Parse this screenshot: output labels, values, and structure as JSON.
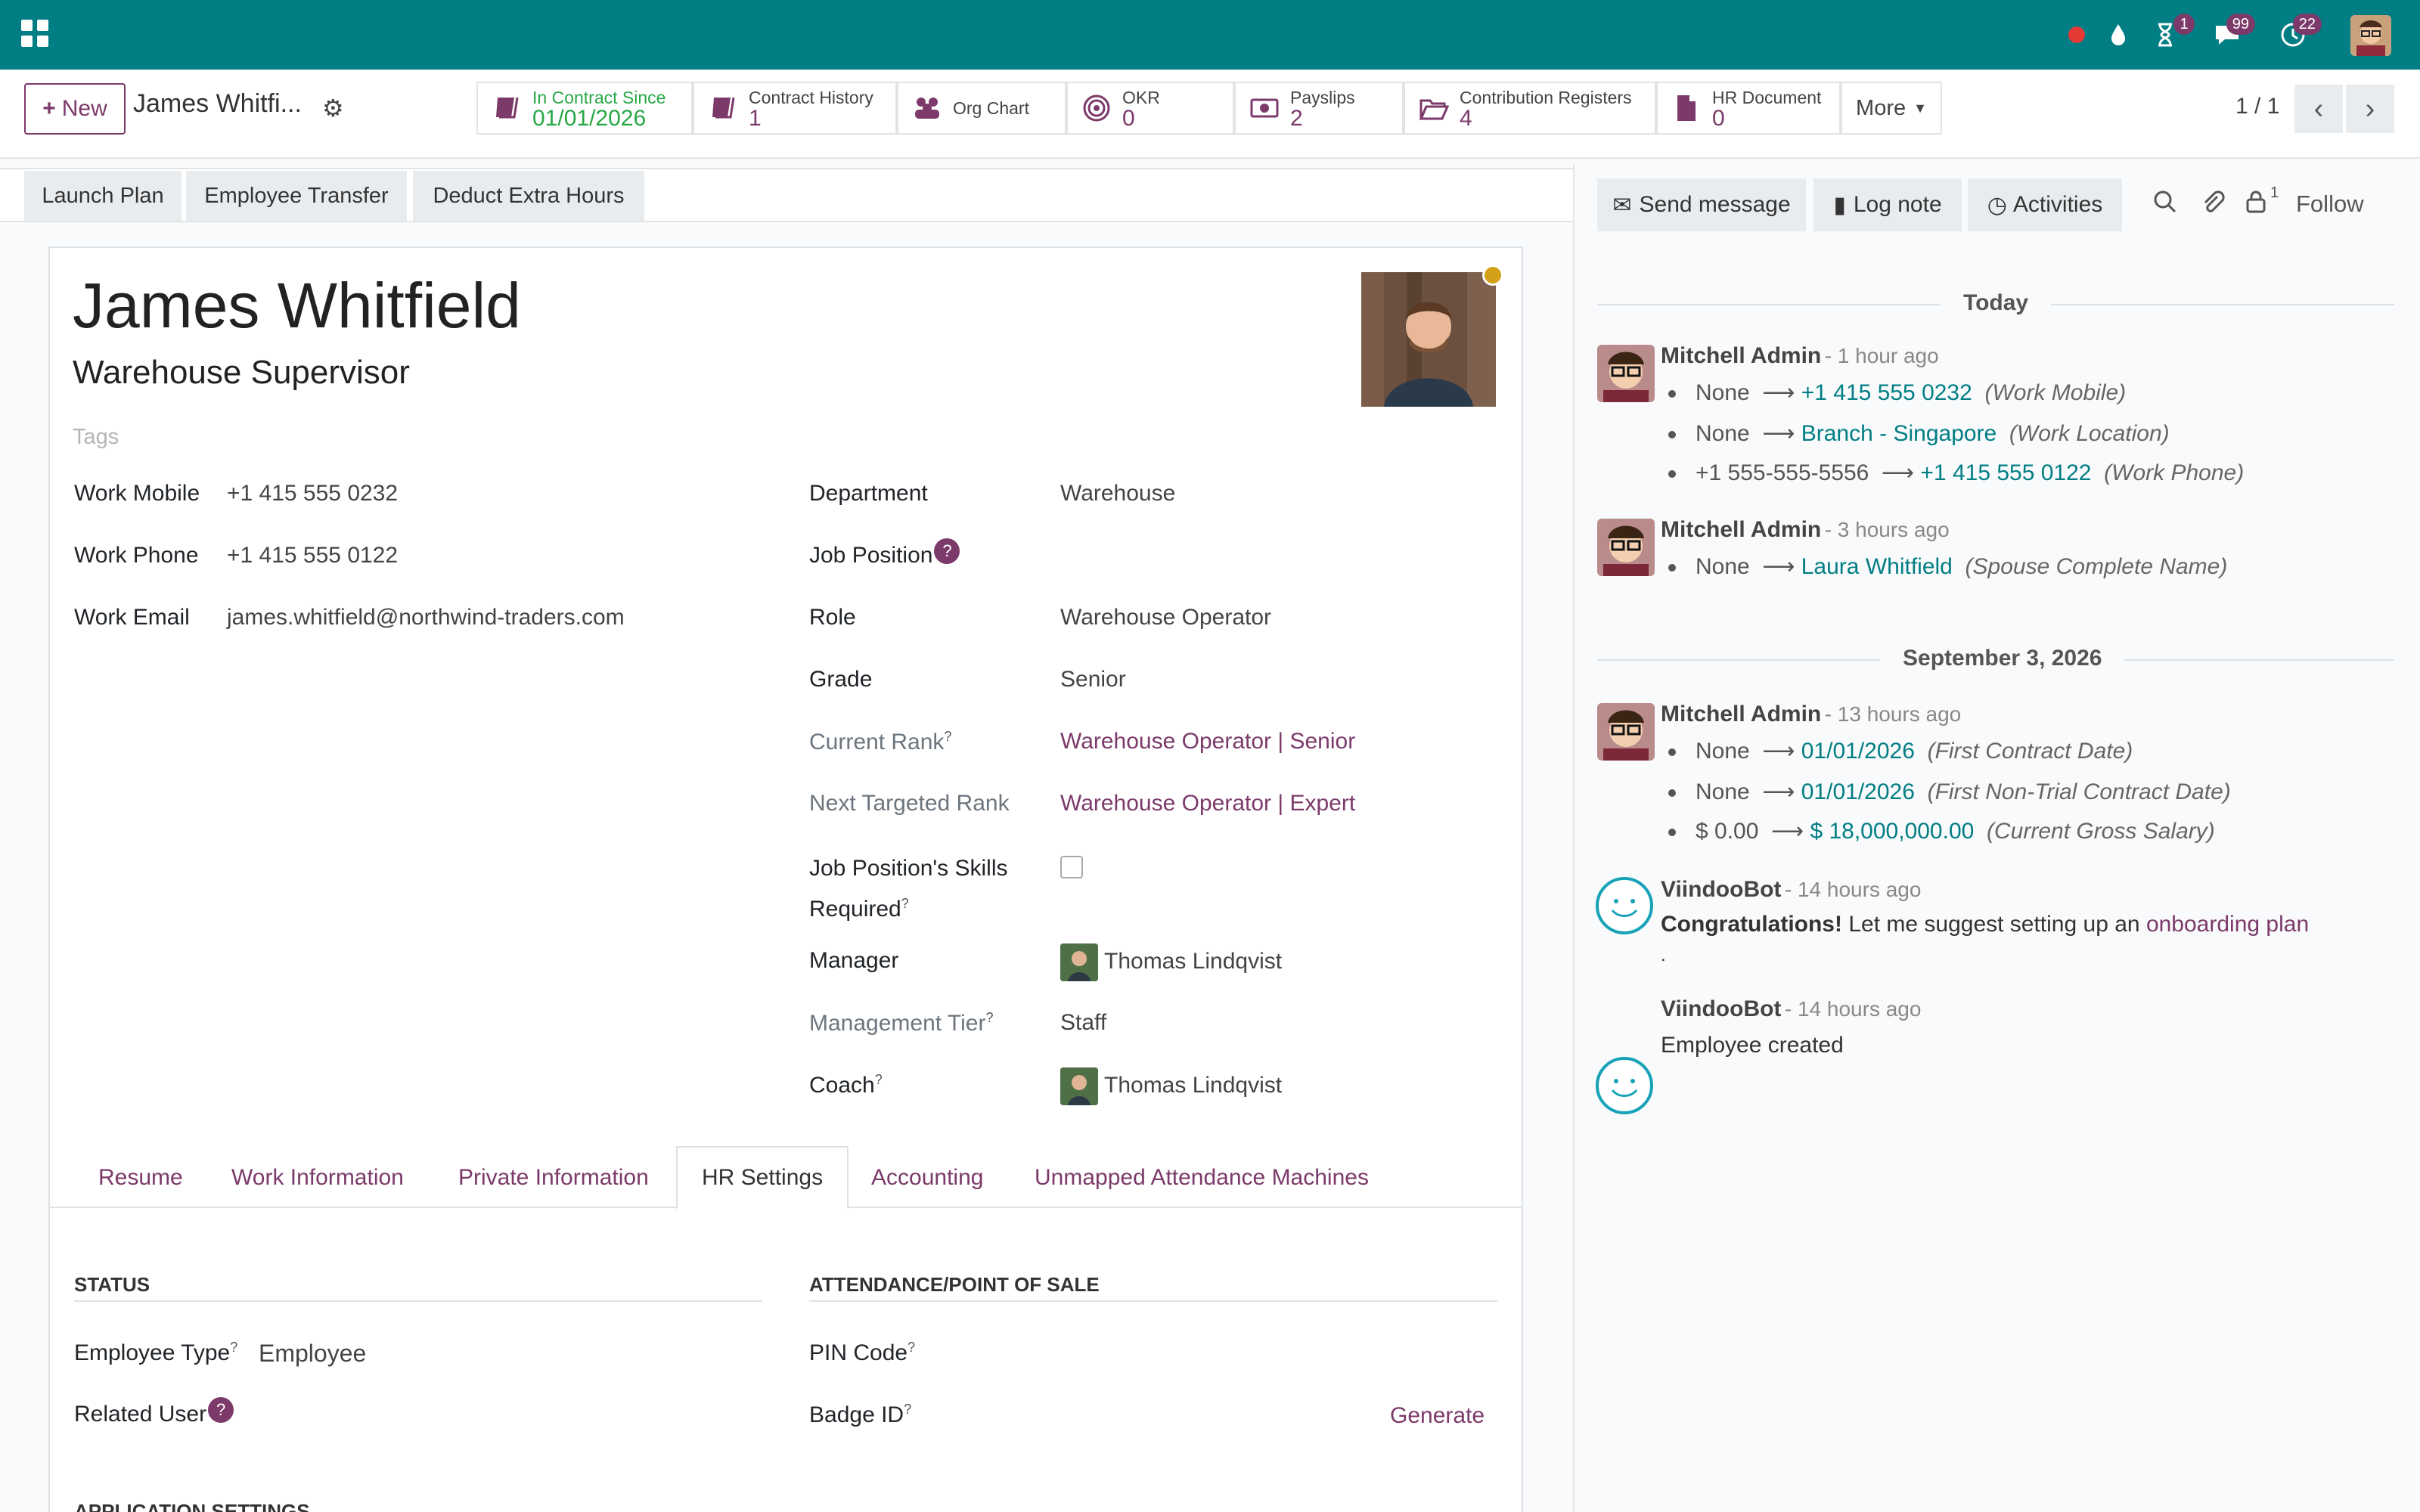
{
  "topbar": {
    "notification_counts": {
      "activities": "1",
      "messages": "99",
      "clock": "22"
    }
  },
  "control": {
    "new_label": "New",
    "record_title": "James Whitfi...",
    "smart_buttons": [
      {
        "label": "In Contract Since",
        "value": "01/01/2026"
      },
      {
        "label": "Contract History",
        "value": "1"
      },
      {
        "label": "Org Chart",
        "value": ""
      },
      {
        "label": "OKR",
        "value": "0"
      },
      {
        "label": "Payslips",
        "value": "2"
      },
      {
        "label": "Contribution Registers",
        "value": "4"
      },
      {
        "label": "HR Document",
        "value": "0"
      }
    ],
    "more_label": "More",
    "pager": "1 / 1"
  },
  "statusbar": {
    "buttons": [
      "Launch Plan",
      "Employee Transfer",
      "Deduct Extra Hours"
    ]
  },
  "employee": {
    "name": "James Whitfield",
    "job_title": "Warehouse Supervisor",
    "tags_placeholder": "Tags"
  },
  "fields_left": [
    {
      "label": "Work Mobile",
      "value": "+1 415 555 0232"
    },
    {
      "label": "Work Phone",
      "value": "+1 415 555 0122"
    },
    {
      "label": "Work Email",
      "value": "james.whitfield@northwind-traders.com"
    }
  ],
  "fields_right": {
    "department": {
      "label": "Department",
      "value": "Warehouse"
    },
    "job_position": {
      "label": "Job Position",
      "value": ""
    },
    "role": {
      "label": "Role",
      "value": "Warehouse Operator"
    },
    "grade": {
      "label": "Grade",
      "value": "Senior"
    },
    "current_rank": {
      "label": "Current Rank",
      "value": "Warehouse Operator | Senior"
    },
    "next_rank": {
      "label": "Next Targeted Rank",
      "value": "Warehouse Operator | Expert"
    },
    "skills_required": {
      "label_1": "Job Position's Skills",
      "label_2": "Required"
    },
    "manager": {
      "label": "Manager",
      "value": "Thomas Lindqvist"
    },
    "management_tier": {
      "label": "Management Tier",
      "value": "Staff"
    },
    "coach": {
      "label": "Coach",
      "value": "Thomas Lindqvist"
    }
  },
  "tabs": [
    "Resume",
    "Work Information",
    "Private Information",
    "HR Settings",
    "Accounting",
    "Unmapped Attendance Machines"
  ],
  "hr_settings": {
    "status_title": "STATUS",
    "attendance_title": "ATTENDANCE/POINT OF SALE",
    "employee_type": {
      "label": "Employee Type",
      "value": "Employee"
    },
    "related_user": {
      "label": "Related User"
    },
    "pin_code": {
      "label": "PIN Code"
    },
    "badge_id": {
      "label": "Badge ID"
    },
    "generate_label": "Generate",
    "app_settings_title": "APPLICATION SETTINGS"
  },
  "chatter": {
    "send_message": "Send message",
    "log_note": "Log note",
    "activities": "Activities",
    "attachments_count": "1",
    "follow": "Follow",
    "sep_today": "Today",
    "sep_date": "September 3, 2026",
    "messages": [
      {
        "author": "Mitchell Admin",
        "when": "- 1 hour ago",
        "changes": [
          {
            "old": "None",
            "new": "+1 415 555 0232",
            "field": "(Work Mobile)"
          },
          {
            "old": "None",
            "new": "Branch - Singapore",
            "field": "(Work Location)"
          },
          {
            "old": "+1 555-555-5556",
            "new": "+1 415 555 0122",
            "field": "(Work Phone)"
          }
        ]
      },
      {
        "author": "Mitchell Admin",
        "when": "- 3 hours ago",
        "changes": [
          {
            "old": "None",
            "new": "Laura Whitfield",
            "field": "(Spouse Complete Name)"
          }
        ]
      },
      {
        "author": "Mitchell Admin",
        "when": "- 13 hours ago",
        "changes": [
          {
            "old": "None",
            "new": "01/01/2026",
            "field": "(First Contract Date)"
          },
          {
            "old": "None",
            "new": "01/01/2026",
            "field": "(First Non-Trial Contract Date)"
          },
          {
            "old": "$ 0.00",
            "new": "$ 18,000,000.00",
            "field": "(Current Gross Salary)"
          }
        ]
      },
      {
        "author": "ViindooBot",
        "when": "- 14 hours ago",
        "bold": "Congratulations!",
        "text": " Let me suggest setting up an ",
        "link": "onboarding plan",
        "trail": "."
      },
      {
        "author": "ViindooBot",
        "when": "- 14 hours ago",
        "text": "Employee created"
      }
    ]
  },
  "colors": {
    "brand": "#017e84",
    "accent": "#7c3a6a",
    "link_blue": "#017e84"
  }
}
